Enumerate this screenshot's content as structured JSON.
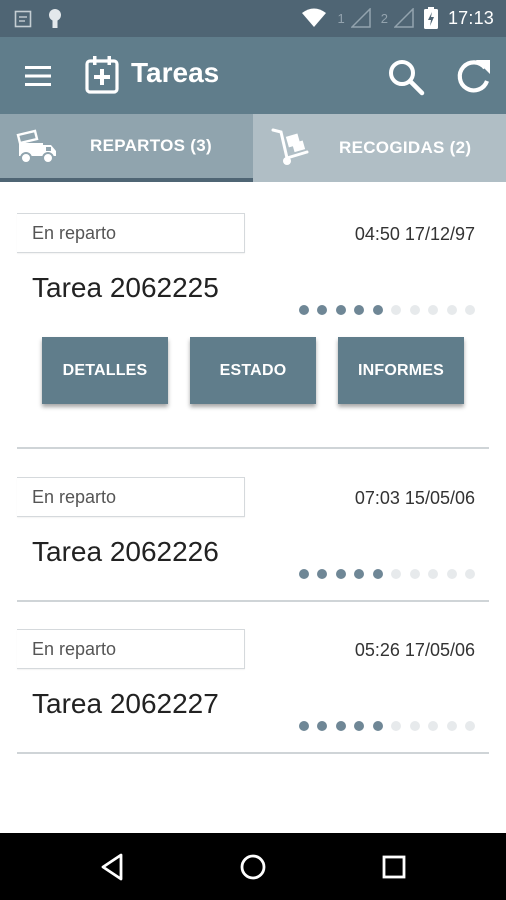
{
  "status_bar": {
    "sim1": "1",
    "sim2": "2",
    "time": "17:13",
    "icons": [
      "notification-icon",
      "android-icon",
      "wifi-icon",
      "signal-icon",
      "battery-charging-icon"
    ]
  },
  "app_bar": {
    "title": "Tareas",
    "icons": {
      "menu": "menu-icon",
      "title": "calendar-add-icon",
      "search": "search-icon",
      "refresh": "refresh-icon"
    }
  },
  "tabs": [
    {
      "label": "REPARTOS (3)",
      "icon": "delivery-truck-icon",
      "active": true
    },
    {
      "label": "RECOGIDAS (2)",
      "icon": "hand-truck-icon",
      "active": false
    }
  ],
  "tasks": [
    {
      "status": "En reparto",
      "datetime": "04:50 17/12/97",
      "title": "Tarea 2062225",
      "progress_steps_done": 5,
      "progress_steps_total": 10,
      "expanded": true
    },
    {
      "status": "En reparto",
      "datetime": "07:03 15/05/06",
      "title": "Tarea 2062226",
      "progress_steps_done": 5,
      "progress_steps_total": 10,
      "expanded": false
    },
    {
      "status": "En reparto",
      "datetime": "05:26 17/05/06",
      "title": "Tarea 2062227",
      "progress_steps_done": 5,
      "progress_steps_total": 10,
      "expanded": false
    }
  ],
  "actions": {
    "details": "DETALLES",
    "status": "ESTADO",
    "reports": "INFORMES"
  },
  "nav_bar": {
    "icons": [
      "back-icon",
      "home-icon",
      "recents-icon"
    ]
  },
  "colors": {
    "primary": "#607d8b",
    "primary_dark": "#4f6574",
    "tab_bg": "#b0bec5",
    "dot_on": "#6f8796",
    "dot_off": "#e7eaec"
  }
}
